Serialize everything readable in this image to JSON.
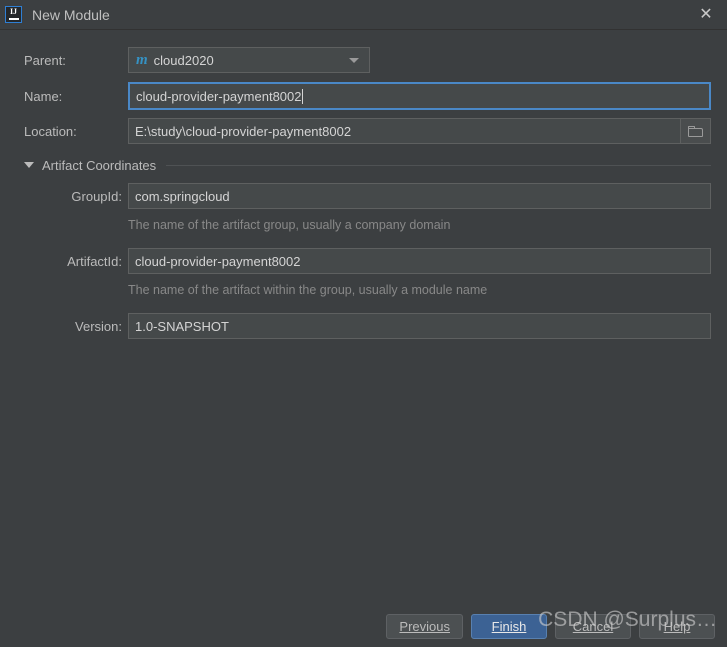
{
  "window": {
    "title": "New Module",
    "app_icon": "intellij-idea-icon",
    "close_icon": "close-icon"
  },
  "colors": {
    "dialog_bg": "#3c3f41",
    "field_bg": "#45494a",
    "field_border": "#5e6060",
    "focus_border": "#4a88c7",
    "default_button_bg": "#3c6294",
    "maven_icon": "#3592c4",
    "label_text": "#bbbbbb",
    "hint_text": "#888888"
  },
  "form": {
    "parent": {
      "label": "Parent:",
      "value": "cloud2020",
      "icon": "maven-module-icon",
      "dropdown_icon": "chevron-down-icon"
    },
    "name": {
      "label": "Name:",
      "value": "cloud-provider-payment8002",
      "focused": true
    },
    "location": {
      "label": "Location:",
      "value": "E:\\study\\cloud-provider-payment8002",
      "browse_icon": "folder-icon"
    }
  },
  "artifact_section": {
    "title": "Artifact Coordinates",
    "expanded": true,
    "toggle_icon": "triangle-down-icon",
    "fields": [
      {
        "label": "GroupId:",
        "value": "com.springcloud",
        "hint": "The name of the artifact group, usually a company domain"
      },
      {
        "label": "ArtifactId:",
        "value": "cloud-provider-payment8002",
        "hint": "The name of the artifact within the group, usually a module name"
      },
      {
        "label": "Version:",
        "value": "1.0-SNAPSHOT",
        "hint": ""
      }
    ]
  },
  "buttons": {
    "previous": {
      "label": "Previous",
      "mnemonic": "P",
      "default": false
    },
    "finish": {
      "label": "Finish",
      "mnemonic": "F",
      "default": true
    },
    "cancel": {
      "label": "Cancel",
      "mnemonic": "C",
      "default": false
    },
    "help": {
      "label": "Help",
      "mnemonic": "H",
      "default": false
    }
  },
  "watermark": {
    "text": "CSDN @Surplus…"
  }
}
